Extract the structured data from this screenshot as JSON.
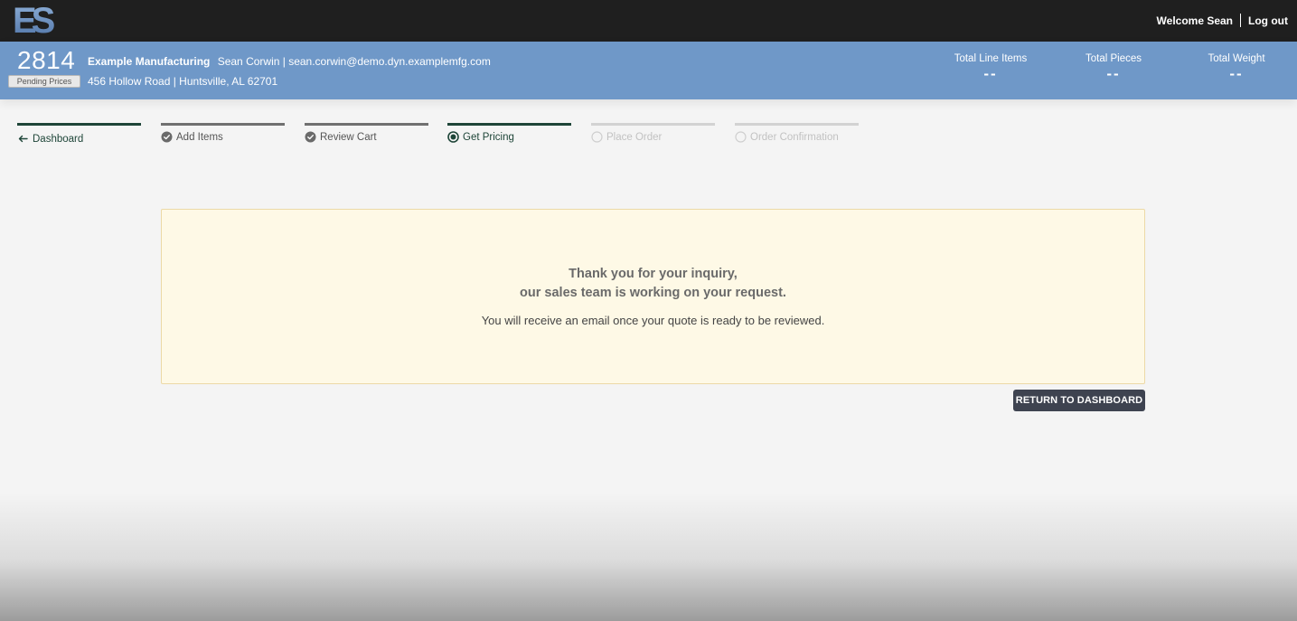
{
  "app": {
    "logo_text": "ES"
  },
  "topbar": {
    "welcome": "Welcome Sean",
    "logout": "Log out"
  },
  "account": {
    "number": "2814",
    "status_badge": "Pending Prices",
    "company": "Example Manufacturing",
    "contact_name": "Sean Corwin",
    "email": "sean.corwin@demo.dyn.examplemfg.com",
    "address": "456 Hollow Road | Huntsville, AL 62701"
  },
  "stats": [
    {
      "label": "Total Line Items",
      "value": "--"
    },
    {
      "label": "Total Pieces",
      "value": "--"
    },
    {
      "label": "Total Weight",
      "value": "--"
    }
  ],
  "steps": [
    {
      "label": "Dashboard",
      "state": "back",
      "icon": "arrow-left-icon"
    },
    {
      "label": "Add Items",
      "state": "done",
      "icon": "check-circle-icon"
    },
    {
      "label": "Review Cart",
      "state": "done",
      "icon": "check-circle-icon"
    },
    {
      "label": "Get Pricing",
      "state": "active",
      "icon": "radio-selected-icon"
    },
    {
      "label": "Place Order",
      "state": "future",
      "icon": "radio-empty-icon"
    },
    {
      "label": "Order Confirmation",
      "state": "future",
      "icon": "radio-empty-icon"
    }
  ],
  "message": {
    "line1": "Thank you for your inquiry,",
    "line2": "our sales team is working on your request.",
    "sub": "You will receive an email once your quote is ready to be reviewed."
  },
  "actions": {
    "return_label": "RETURN TO DASHBOARD"
  },
  "colors": {
    "topbar": "#1f1f1f",
    "header": "#6f98c8",
    "step_active": "#1e4538",
    "panel_bg": "#fef9e6",
    "button_bg": "#3e4350"
  }
}
